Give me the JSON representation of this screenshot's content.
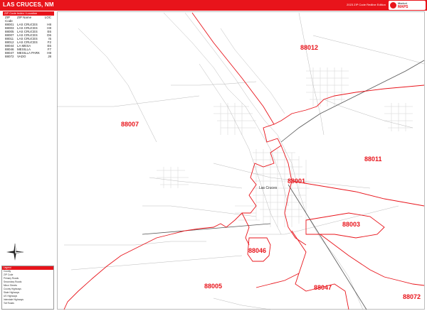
{
  "header": {
    "title": "LAS CRUCES, NM",
    "edition": "2023 ZIP Code Redline Edition"
  },
  "logo": {
    "line1": "Market",
    "line2": "MAPS"
  },
  "zip_table": {
    "heading": "ZIP Code Index / Location",
    "columns": [
      "ZIP Code",
      "ZIP Name",
      "LOC"
    ],
    "rows": [
      [
        "88001",
        "LAS CRUCES",
        "H8"
      ],
      [
        "88003",
        "LAS CRUCES",
        "H8"
      ],
      [
        "88005",
        "LAS CRUCES",
        "E6"
      ],
      [
        "88007",
        "LAS CRUCES",
        "D6"
      ],
      [
        "88011",
        "LAS CRUCES",
        "I5"
      ],
      [
        "88012",
        "LAS CRUCES",
        "F2"
      ],
      [
        "88044",
        "LA MESA",
        "E6"
      ],
      [
        "88046",
        "MESILLA",
        "F7"
      ],
      [
        "88047",
        "MESILLA PARK",
        "H8"
      ],
      [
        "88072",
        "VADO",
        "J8"
      ]
    ]
  },
  "map": {
    "zip_labels": [
      {
        "id": "88012",
        "text": "88012"
      },
      {
        "id": "88007",
        "text": "88007"
      },
      {
        "id": "88011",
        "text": "88011"
      },
      {
        "id": "88001",
        "text": "88001"
      },
      {
        "id": "88003",
        "text": "88003"
      },
      {
        "id": "88046",
        "text": "88046"
      },
      {
        "id": "88005",
        "text": "88005"
      },
      {
        "id": "88047",
        "text": "88047"
      },
      {
        "id": "88072",
        "text": "88072"
      }
    ],
    "city_label": "Las Cruces",
    "boundary_color": "#e8141b",
    "street_color": "#8a8a8a"
  },
  "legend": {
    "heading": "Legend",
    "items": [
      "County",
      "ZIP Code",
      "Primary Roads",
      "Secondary Roads",
      "Minor Streets",
      "County Highways",
      "State Highways",
      "US Highways",
      "Interstate Highways",
      "Toll Roads"
    ]
  },
  "compass": {
    "north": "N",
    "south": "S",
    "east": "E",
    "west": "W"
  }
}
